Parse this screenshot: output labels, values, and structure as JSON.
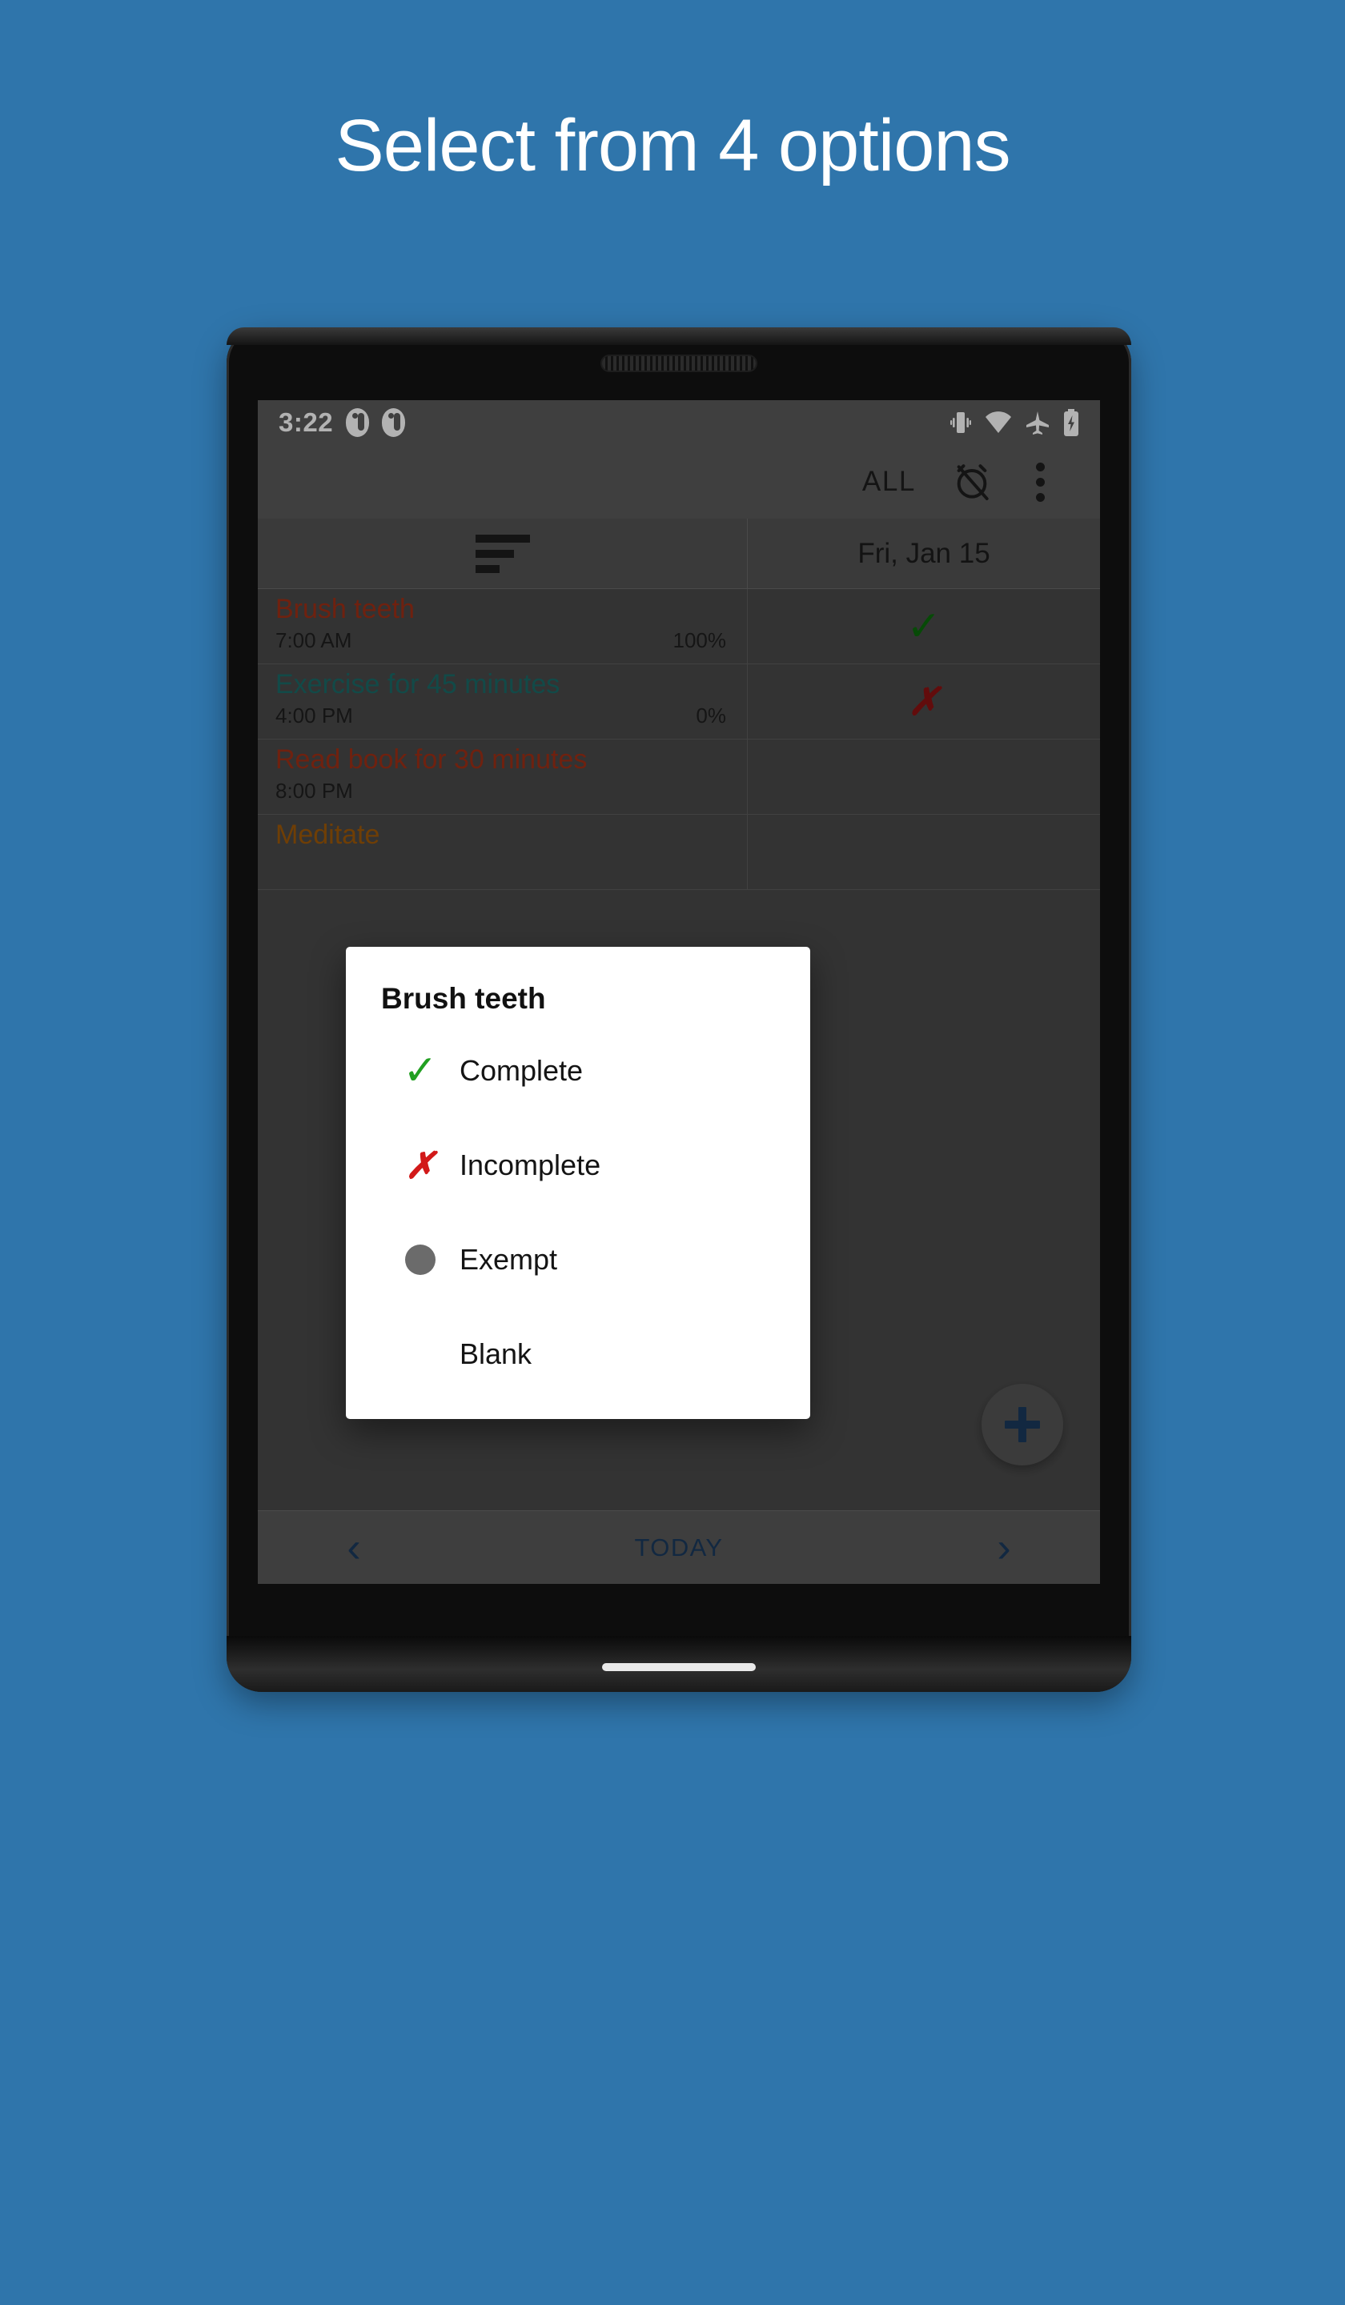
{
  "promo": {
    "headline": "Select from 4 options",
    "background_color": "#2f75ab",
    "text_color": "#ffffff"
  },
  "status_bar": {
    "time": "3:22",
    "notification_icons": [
      "notification-dot-icon",
      "notification-dot-icon"
    ],
    "system_icons": [
      "vibrate-icon",
      "wifi-icon",
      "airplane-mode-icon",
      "battery-charging-icon"
    ]
  },
  "toolbar": {
    "filter_label": "ALL",
    "alarm_icon": "alarm-off-icon",
    "overflow_icon": "more-vertical-icon"
  },
  "table": {
    "sort_icon": "sort-list-icon",
    "date_column_header": "Fri, Jan 15",
    "rows": [
      {
        "name": "Brush teeth",
        "name_color": "#a03016",
        "time": "7:00 AM",
        "percent": "100%",
        "status": "complete",
        "status_glyph": "✓"
      },
      {
        "name": "Exercise for 45 minutes",
        "name_color": "#1a6b68",
        "time": "4:00 PM",
        "percent": "0%",
        "status": "incomplete",
        "status_glyph": "✗"
      },
      {
        "name": "Read book for 30 minutes",
        "name_color": "#a03016",
        "time": "8:00 PM",
        "percent": "",
        "status": "",
        "status_glyph": ""
      },
      {
        "name": "Meditate",
        "name_color": "#a05a08",
        "time": "",
        "percent": "",
        "status": "",
        "status_glyph": ""
      }
    ]
  },
  "fab": {
    "icon": "plus-icon",
    "color": "#1b3a5e"
  },
  "bottom_nav": {
    "prev_label": "‹",
    "today_label": "TODAY",
    "next_label": "›",
    "color": "#1b3a5e"
  },
  "dialog": {
    "title": "Brush teeth",
    "options": [
      {
        "label": "Complete",
        "icon": "check-icon",
        "glyph": "✓",
        "color": "#21a021"
      },
      {
        "label": "Incomplete",
        "icon": "cross-icon",
        "glyph": "✗",
        "color": "#d21919"
      },
      {
        "label": "Exempt",
        "icon": "circle-icon",
        "glyph": "",
        "color": "#6b6b6b"
      },
      {
        "label": "Blank",
        "icon": "none",
        "glyph": "",
        "color": ""
      }
    ]
  },
  "device": {
    "gesture_bar": "home-gesture-bar",
    "speaker": "earpiece-speaker"
  }
}
